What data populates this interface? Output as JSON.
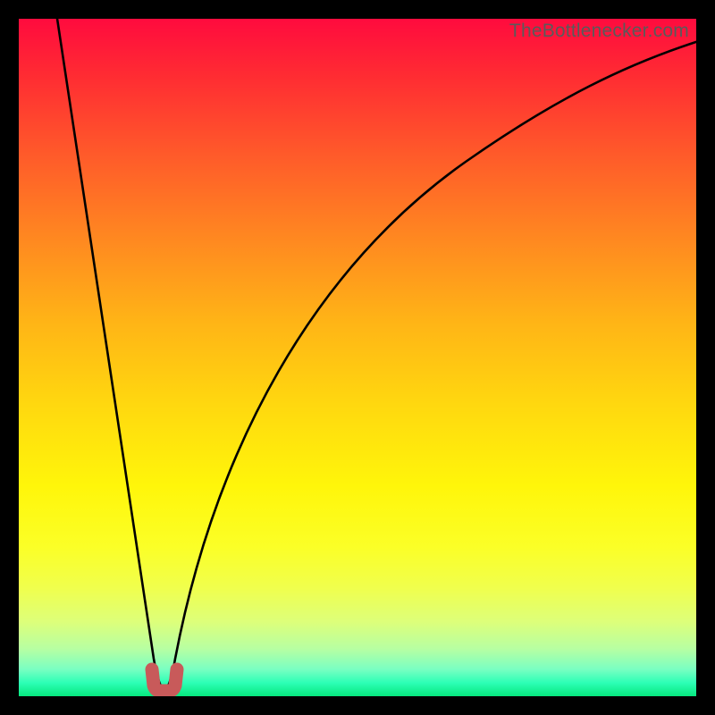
{
  "watermark": {
    "text": "TheBottlenecker.com"
  },
  "chart_data": {
    "type": "line",
    "title": "",
    "xlabel": "",
    "ylabel": "",
    "xlim": [
      0,
      100
    ],
    "ylim": [
      0,
      100
    ],
    "x": [
      0,
      2,
      4,
      6,
      8,
      10,
      12,
      14,
      16,
      18,
      19,
      20,
      21,
      22,
      23,
      24,
      25,
      27,
      30,
      34,
      38,
      42,
      46,
      50,
      55,
      60,
      65,
      70,
      75,
      80,
      85,
      90,
      95,
      100
    ],
    "series": [
      {
        "name": "bottleneck-curve",
        "values": [
          103,
          92.5,
          82,
          71.5,
          61,
          50.5,
          40,
          29.5,
          19,
          8.5,
          3.2,
          1.0,
          0.6,
          1.0,
          3.8,
          9.0,
          14.0,
          23.0,
          34.5,
          46.5,
          55.8,
          63.2,
          69.2,
          74.2,
          79.4,
          83.6,
          87.0,
          89.8,
          92.2,
          94.2,
          95.8,
          97.2,
          98.4,
          99.4
        ]
      }
    ],
    "marker": {
      "name": "minimum-marker",
      "x_range": [
        19.4,
        22.6
      ],
      "y": 0.5,
      "color": "#c85a5a"
    },
    "gradient_stops": [
      {
        "pos": 0.0,
        "color": "#ff0b3e"
      },
      {
        "pos": 0.33,
        "color": "#ff8a20"
      },
      {
        "pos": 0.69,
        "color": "#fff60a"
      },
      {
        "pos": 0.93,
        "color": "#b7ffa2"
      },
      {
        "pos": 1.0,
        "color": "#06e87e"
      }
    ]
  }
}
